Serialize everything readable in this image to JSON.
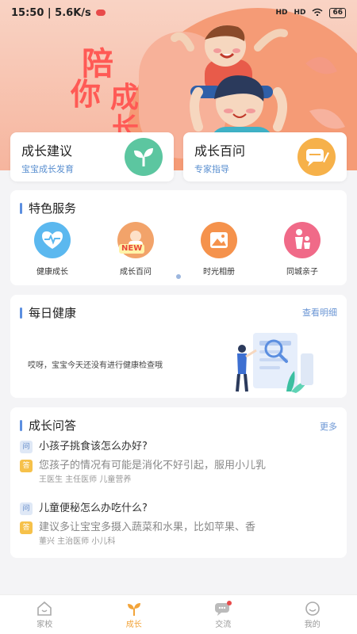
{
  "status_bar": {
    "time": "15:50 | 5.6K/s",
    "signal1": "HD",
    "signal2": "HD",
    "battery": "66"
  },
  "hero": {
    "slogan": [
      "陪",
      "你",
      "成",
      "长"
    ]
  },
  "top_cards": [
    {
      "title": "成长建议",
      "subtitle": "宝宝成长发育",
      "icon": "sprout-icon"
    },
    {
      "title": "成长百问",
      "subtitle": "专家指导",
      "icon": "chat-pen-icon"
    }
  ],
  "services": {
    "title": "特色服务",
    "items": [
      {
        "label": "健康成长",
        "icon": "heart-pulse-icon",
        "color": "#5bb8ef"
      },
      {
        "label": "成长百问",
        "icon": "growth-new-icon",
        "color": "#f2a36a",
        "badge": "NEW"
      },
      {
        "label": "时光相册",
        "icon": "photo-album-icon",
        "color": "#f5924c"
      },
      {
        "label": "同城亲子",
        "icon": "parent-child-icon",
        "color": "#f06a88"
      }
    ]
  },
  "daily_health": {
    "title": "每日健康",
    "more": "查看明细",
    "empty_text": "哎呀，宝宝今天还没有进行健康检查哦"
  },
  "qa": {
    "title": "成长问答",
    "more": "更多",
    "q_tag": "问",
    "a_tag": "答",
    "items": [
      {
        "question": "小孩子挑食该怎么办好?",
        "answer": "您孩子的情况有可能是消化不好引起，服用小儿乳",
        "meta": "王医生 主任医师 儿童营养"
      },
      {
        "question": "儿童便秘怎么办吃什么?",
        "answer": "建议多让宝宝多摄入蔬菜和水果，比如苹果、香",
        "meta": "董兴 主治医师 小儿科"
      }
    ]
  },
  "nav": [
    {
      "label": "家校",
      "icon": "home-icon"
    },
    {
      "label": "成长",
      "icon": "sprout-icon",
      "active": true
    },
    {
      "label": "交流",
      "icon": "chat-icon"
    },
    {
      "label": "我的",
      "icon": "smile-face-icon"
    }
  ]
}
